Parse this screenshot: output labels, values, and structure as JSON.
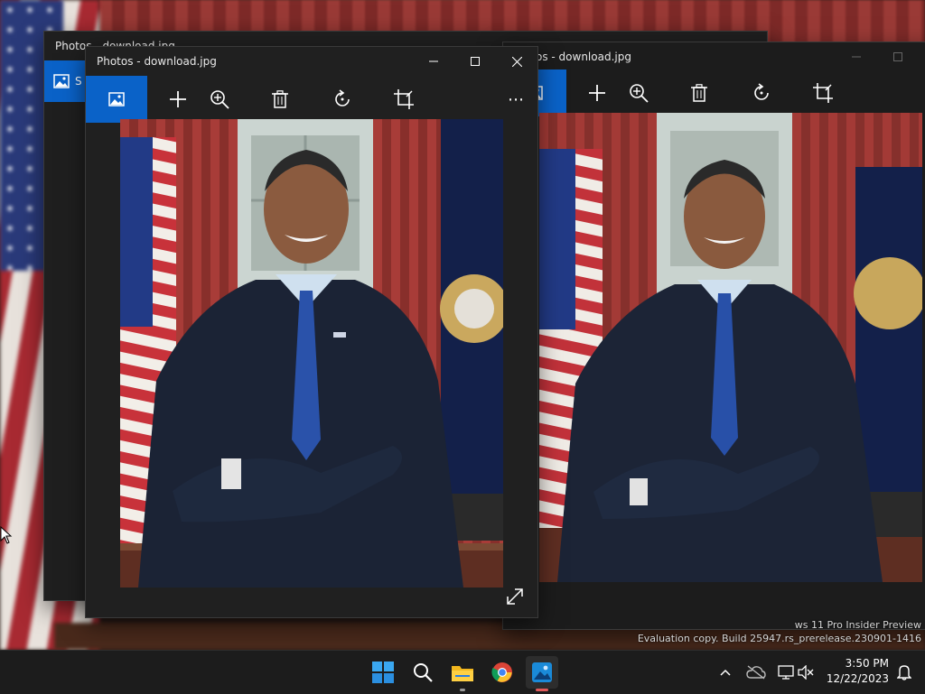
{
  "windows": {
    "back_left": {
      "title": "Photos - download.jpg",
      "sidebar_label": "S"
    },
    "right": {
      "title": "os - download.jpg"
    },
    "front": {
      "title": "Photos - download.jpg"
    }
  },
  "toolbar": {
    "icons": [
      "image-icon",
      "add-icon",
      "zoom-in-icon",
      "delete-icon",
      "rotate-icon",
      "crop-icon",
      "more-icon"
    ],
    "more_label": "⋯"
  },
  "watermark": {
    "line1": "ws 11 Pro Insider Preview",
    "line2": "Evaluation copy. Build 25947.rs_prerelease.230901-1416"
  },
  "taskbar": {
    "icons": [
      "windows-start-icon",
      "search-icon",
      "file-explorer-icon",
      "chrome-icon",
      "photos-icon"
    ],
    "tray_icons": [
      "chevron-up-icon",
      "onedrive-icon",
      "network-icon",
      "volume-muted-icon",
      "notifications-icon"
    ],
    "time": "3:50 PM",
    "date": "12/22/2023"
  },
  "colors": {
    "accent": "#0a62c8",
    "window_bg": "#202020",
    "taskbar_bg": "#1c1c1c"
  }
}
